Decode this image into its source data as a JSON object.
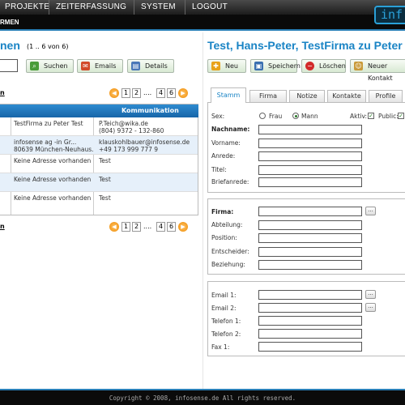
{
  "topnav": {
    "items": [
      "PROJEKTE",
      "ZEITERFASSUNG",
      "SYSTEM",
      "LOGOUT"
    ],
    "logo_text": "inf"
  },
  "subnav": {
    "label": "RMEN"
  },
  "left": {
    "title": "nen",
    "count": "(1 .. 6 von 6)",
    "buttons": {
      "search": "Suchen",
      "emails": "Emails",
      "details": "Details"
    },
    "pager_label": "n",
    "pager_pages": [
      "1",
      "2",
      "4",
      "6"
    ],
    "pager_dots": "....",
    "table": {
      "header_comm": "Kommunikation",
      "rows": [
        {
          "c1": [
            "TestFirma zu Peter Test",
            ""
          ],
          "c2": [
            "P.Teich@wika.de",
            "(804) 9372 - 132-860"
          ]
        },
        {
          "c1": [
            "infosense ag -in Gr...",
            "80639 München-Neuhaus..."
          ],
          "c2": [
            "klauskohlbauer@infosense.de",
            "+49 173 999 777 9"
          ]
        },
        {
          "c1": [
            "Keine Adresse vorhanden",
            ""
          ],
          "c2": [
            "Test",
            ""
          ]
        },
        {
          "c1": [
            "Keine Adresse vorhanden",
            ""
          ],
          "c2": [
            "Test",
            ""
          ]
        },
        {
          "c1": [
            "Keine Adresse vorhanden",
            ""
          ],
          "c2": [
            "Test",
            ""
          ]
        }
      ]
    }
  },
  "right": {
    "title": "Test, Hans-Peter, TestFirma zu Peter T",
    "buttons": {
      "new": "Neu",
      "save": "Speichern",
      "delete": "Löschen",
      "new_contact": "Neuer Kontakt"
    },
    "tabs": [
      "Stamm",
      "Firma",
      "Notize",
      "Kontakte",
      "Profile"
    ],
    "personal": {
      "sex_label": "Sex:",
      "sex_female": "Frau",
      "sex_male": "Mann",
      "sex_selected": "Mann",
      "active_label": "Aktiv:",
      "public_label": "Public:",
      "fields": [
        "Nachname:",
        "Vorname:",
        "Anrede:",
        "Titel:",
        "Briefanrede:"
      ]
    },
    "company": {
      "fields": [
        "Firma:",
        "Abteilung:",
        "Position:",
        "Entscheider:",
        "Beziehung:"
      ],
      "lookup": "..."
    },
    "contact": {
      "fields": [
        "Email 1:",
        "Email 2:",
        "Telefon 1:",
        "Telefon 2:",
        "Fax 1:"
      ]
    }
  },
  "footer": {
    "copyright": "Copyright © 2008, infosense.de All rights reserved."
  },
  "colors": {
    "accent": "#1a84c5",
    "header_blue": "#1765a8",
    "pager_orange": "#ef8a00"
  }
}
